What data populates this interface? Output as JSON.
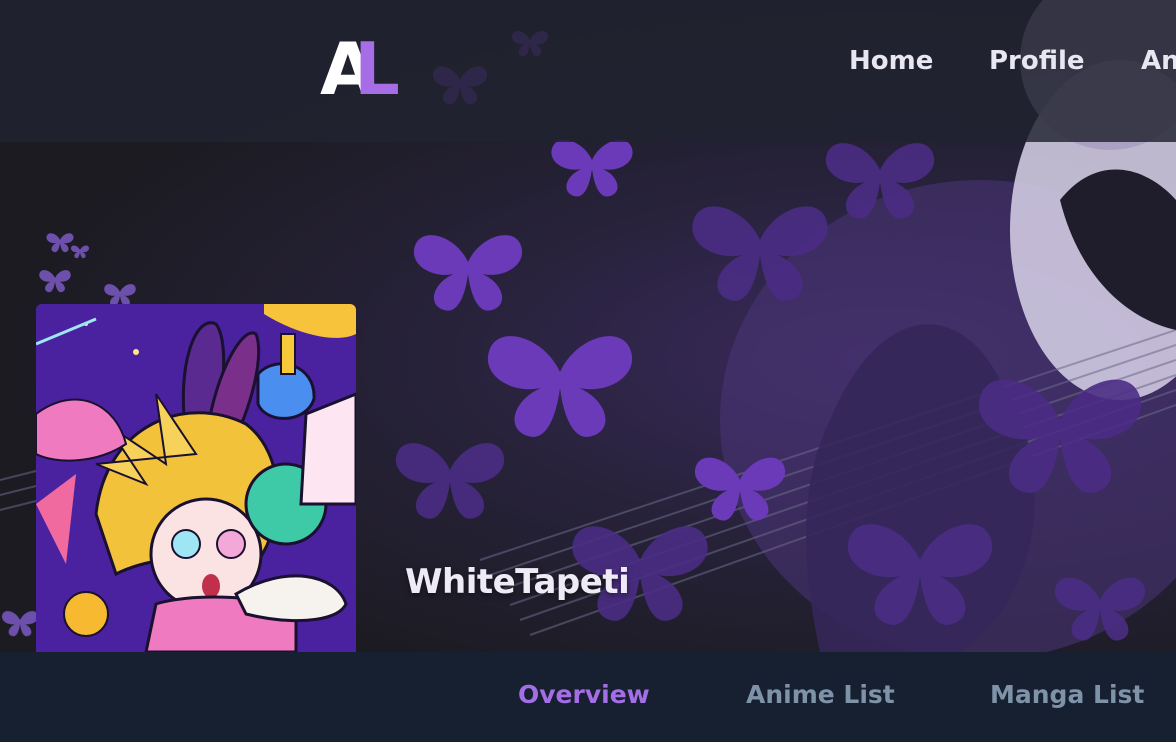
{
  "app": {
    "logo_primary": "A",
    "logo_secondary": "L",
    "accent_color": "#a66de6"
  },
  "nav": {
    "items": [
      {
        "label": "Home"
      },
      {
        "label": "Profile"
      },
      {
        "label": "An"
      }
    ]
  },
  "profile": {
    "username": "WhiteTapeti"
  },
  "tabs": {
    "items": [
      {
        "label": "Overview",
        "active": true
      },
      {
        "label": "Anime List",
        "active": false
      },
      {
        "label": "Manga List",
        "active": false
      }
    ]
  }
}
